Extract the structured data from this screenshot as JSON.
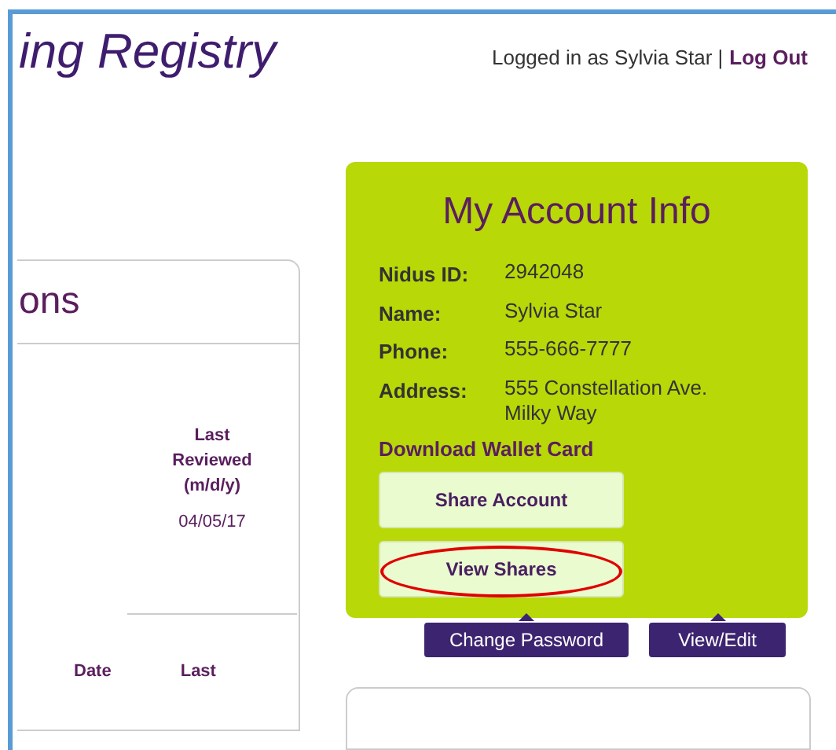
{
  "header": {
    "title_fragment": "ing Registry",
    "login_text": "Logged in as Sylvia Star |",
    "logout_link": "Log Out"
  },
  "left_panel": {
    "heading": "ons",
    "column_header": "Last\nReviewed\n(m/d/y)",
    "date_value": "04/05/17",
    "lower_headers": [
      "Date",
      "Last"
    ]
  },
  "account": {
    "title": "My Account Info",
    "fields": [
      {
        "label": "Nidus ID:",
        "value": "2942048"
      },
      {
        "label": "Name:",
        "value": "Sylvia Star"
      },
      {
        "label": "Phone:",
        "value": "555-666-7777"
      },
      {
        "label": "Address:",
        "value": "555 Constellation Ave.\nMilky Way"
      }
    ],
    "download_link": "Download Wallet Card",
    "buttons": [
      {
        "label": "Share Account",
        "highlighted": false
      },
      {
        "label": "View Shares",
        "highlighted": true
      }
    ]
  },
  "actions": [
    "Change Password",
    "View/Edit"
  ]
}
